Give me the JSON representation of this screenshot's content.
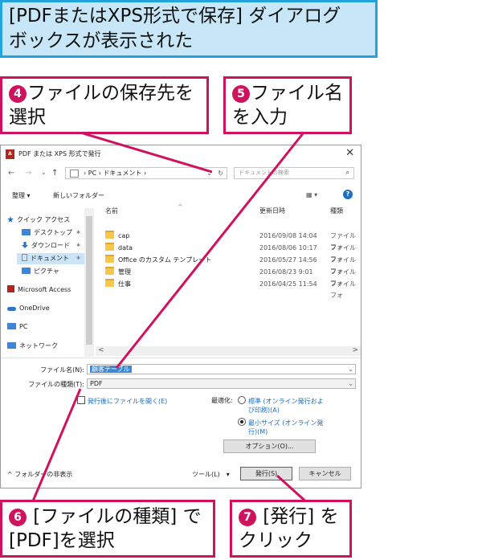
{
  "callouts": {
    "top": {
      "line1": "[PDFまたはXPS形式で保存] ダイアログ",
      "line2": "ボックスが表示された"
    },
    "c4": {
      "num": "4",
      "line1": "ファイルの保存先を",
      "line2": "選択"
    },
    "c5": {
      "num": "5",
      "line1": "ファイル名",
      "line2": "を入力"
    },
    "c6": {
      "num": "6",
      "line1": " [ファイルの種類] で",
      "line2": "[PDF]を選択"
    },
    "c7": {
      "num": "7",
      "line1": " [発行] を",
      "line2": "クリック"
    }
  },
  "dialog": {
    "title": "PDF または XPS 形式で発行",
    "app_icon_label": "A",
    "close": "✕",
    "nav": {
      "back": "←",
      "forward": "→",
      "recent": "⌄",
      "up": "↑",
      "path": "› PC › ドキュメント ›",
      "dropdown": "⌄",
      "refresh": "↻",
      "search_placeholder": "ドキュメントの検索",
      "search_icon": "⌕"
    },
    "toolbar": {
      "organize": "整理 ▾",
      "new_folder": "新しいフォルダー",
      "view": "▦ ▾",
      "help": "?"
    },
    "navpane": [
      {
        "label": "クイック アクセス",
        "icon": "star-icon",
        "color": "#1d6fc2"
      },
      {
        "label": "デスクトップ",
        "icon": "desktop-icon",
        "color": "#3b86d9",
        "pin": "✱"
      },
      {
        "label": "ダウンロード",
        "icon": "download-icon",
        "color": "#2f74c8",
        "pin": "✱"
      },
      {
        "label": "ドキュメント",
        "icon": "documents-icon",
        "color": "#8a8a8a",
        "pin": "✱"
      },
      {
        "label": "ピクチャ",
        "icon": "pictures-icon",
        "color": "#3b86d9"
      },
      {
        "label": "Microsoft Access",
        "icon": "access-icon",
        "color": "#b3261e"
      },
      {
        "label": "OneDrive",
        "icon": "onedrive-icon",
        "color": "#2f74c8"
      },
      {
        "label": "PC",
        "icon": "pc-icon",
        "color": "#3b86d9"
      },
      {
        "label": "ネットワーク",
        "icon": "network-icon",
        "color": "#3b86d9"
      }
    ],
    "columns": {
      "name": "名前",
      "date": "更新日時",
      "type": "種類",
      "sort": "^"
    },
    "files": [
      {
        "name": "cap",
        "date": "2016/09/08 14:04",
        "type": "ファイル フォ"
      },
      {
        "name": "data",
        "date": "2016/08/06 10:17",
        "type": "ファイル フォ"
      },
      {
        "name": "Office のカスタム テンプレート",
        "date": "2016/05/27 14:56",
        "type": "ファイル フォ"
      },
      {
        "name": "管理",
        "date": "2016/08/23 9:01",
        "type": "ファイル フォ"
      },
      {
        "name": "仕事",
        "date": "2016/04/25 11:54",
        "type": "ファイル フォ"
      }
    ],
    "hscroll": {
      "left": "<",
      "right": ">"
    },
    "filename_label": "ファイル名(N):",
    "filename_value": "顧客テーブル",
    "filetype_label": "ファイルの種類(T):",
    "filetype_value": "PDF",
    "open_after": "発行後にファイルを開く(E)",
    "optimize_label": "最適化:",
    "opt_standard": {
      "line1": "標準 (オンライン発行およ",
      "line2": "び印刷)(A)"
    },
    "opt_minimum": {
      "line1": "最小サイズ (オンライン発",
      "line2": "行)(M)"
    },
    "options_button": "オプション(O)...",
    "hide_folders": "^ フォルダーの非表示",
    "tools": "ツール(L)　▾",
    "publish_button": "発行(S)",
    "cancel_button": "キャンセル",
    "dropdown_glyph": "⌄"
  }
}
